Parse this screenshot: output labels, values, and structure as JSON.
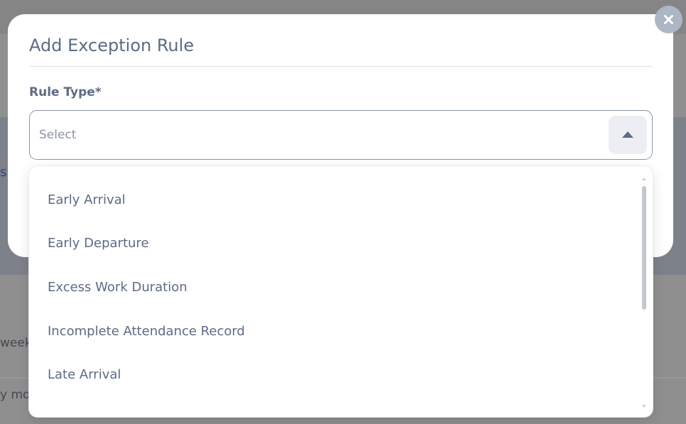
{
  "background": {
    "link_fragment": "s",
    "row1_fragment": "week",
    "row2_fragment": "y mor"
  },
  "modal": {
    "title": "Add Exception Rule",
    "field_label": "Rule Type*",
    "select": {
      "placeholder": "Select",
      "expanded": true
    }
  },
  "dropdown": {
    "options": [
      "Early Arrival",
      "Early Departure",
      "Excess Work Duration",
      "Incomplete Attendance Record",
      "Late Arrival"
    ]
  },
  "icons": {
    "close": "close-icon",
    "toggle": "caret-up-icon"
  }
}
